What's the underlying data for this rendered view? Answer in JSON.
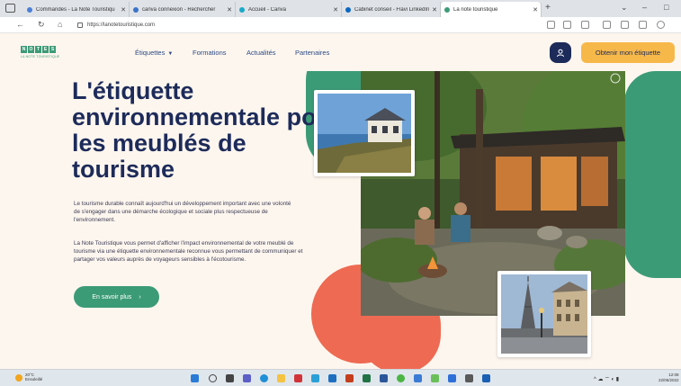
{
  "browser": {
    "tabs": [
      {
        "label": "Commandes - La Note Touristiqu",
        "favicon_color": "#4a7fd6"
      },
      {
        "label": "canva connexion - Rechercher",
        "favicon_color": "#3a74c9"
      },
      {
        "label": "Accueil - Canva",
        "favicon_color": "#1aa9c9"
      },
      {
        "label": "Cabinet conseil - Flavi LinkedIn",
        "favicon_color": "#0a66c2"
      },
      {
        "label": "La note touristique",
        "favicon_color": "#3c9b77"
      }
    ],
    "url": "https://lanotetouristique.com"
  },
  "header": {
    "logo_letters": [
      "N",
      "O",
      "T",
      "E",
      "S"
    ],
    "logo_caption": "LA NOTE TOURISTIQUE",
    "nav": {
      "etiquettes": "Étiquettes",
      "formations": "Formations",
      "actualites": "Actualités",
      "partenaires": "Partenaires"
    },
    "cta_label": "Obtenir mon étiquette"
  },
  "hero": {
    "title": "L'étiquette environnementale pour les meublés de tourisme",
    "paragraph_1": "Le tourisme durable connaît aujourd'hui un développement important avec une volonté de s'engager dans une démarche écologique et sociale plus respectueuse de l'environnement.",
    "paragraph_2": "La Note Touristique vous permet d'afficher l'impact environnemental de votre meublé de tourisme via une étiquette environnementale reconnue vous permettant de communiquer et partager vos valeurs auprès de voyageurs sensibles à l'écotourisme.",
    "more_label": "En savoir plus",
    "more_arrow": "›"
  },
  "taskbar": {
    "weather_temp": "20°C",
    "weather_desc": "Ensoleillé",
    "clock_time": "12:08",
    "clock_date": "22/06/2022"
  },
  "colors": {
    "navy": "#1d2b5a",
    "green": "#3c9b77",
    "orange": "#f7b84a",
    "red": "#ee6a52",
    "cream": "#fdf6ee"
  }
}
